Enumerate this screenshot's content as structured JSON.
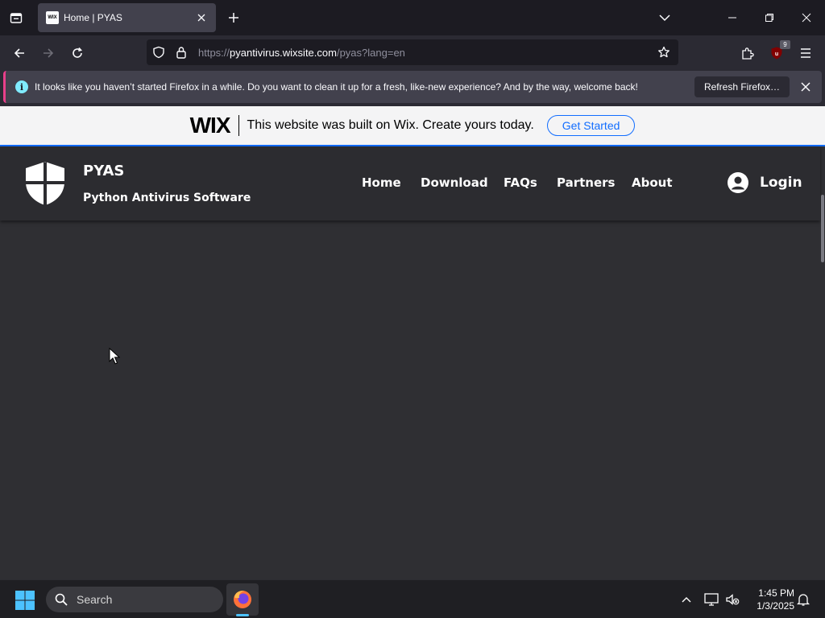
{
  "browser": {
    "tab": {
      "favicon_text": "WIX",
      "title": "Home | PYAS"
    },
    "url": {
      "scheme": "https://",
      "host": "pyantivirus.wixsite.com",
      "path": "/pyas?lang=en"
    },
    "extension_badge": "9",
    "notification": {
      "text": "It looks like you haven’t started Firefox in a while. Do you want to clean it up for a fresh, like-new experience? And by the way, welcome back!",
      "button_label": "Refresh Firefox…"
    }
  },
  "wix_banner": {
    "logo": "WIX",
    "tagline": "This website was built on Wix. Create yours today.",
    "cta": "Get Started",
    "accent": "#116dff"
  },
  "site": {
    "name": "PYAS",
    "tagline": "Python Antivirus Software",
    "nav": [
      "Home",
      "Download",
      "FAQs",
      "Partners",
      "About"
    ],
    "login": "Login",
    "background": "#2f2f33"
  },
  "taskbar": {
    "search_label": "Search",
    "time": "1:45 PM",
    "date": "1/3/2025"
  },
  "colors": {
    "notification_accent": "#e83f8a",
    "info_icon": "#80ebff",
    "taskbar_indicator": "#4cc2ff"
  }
}
